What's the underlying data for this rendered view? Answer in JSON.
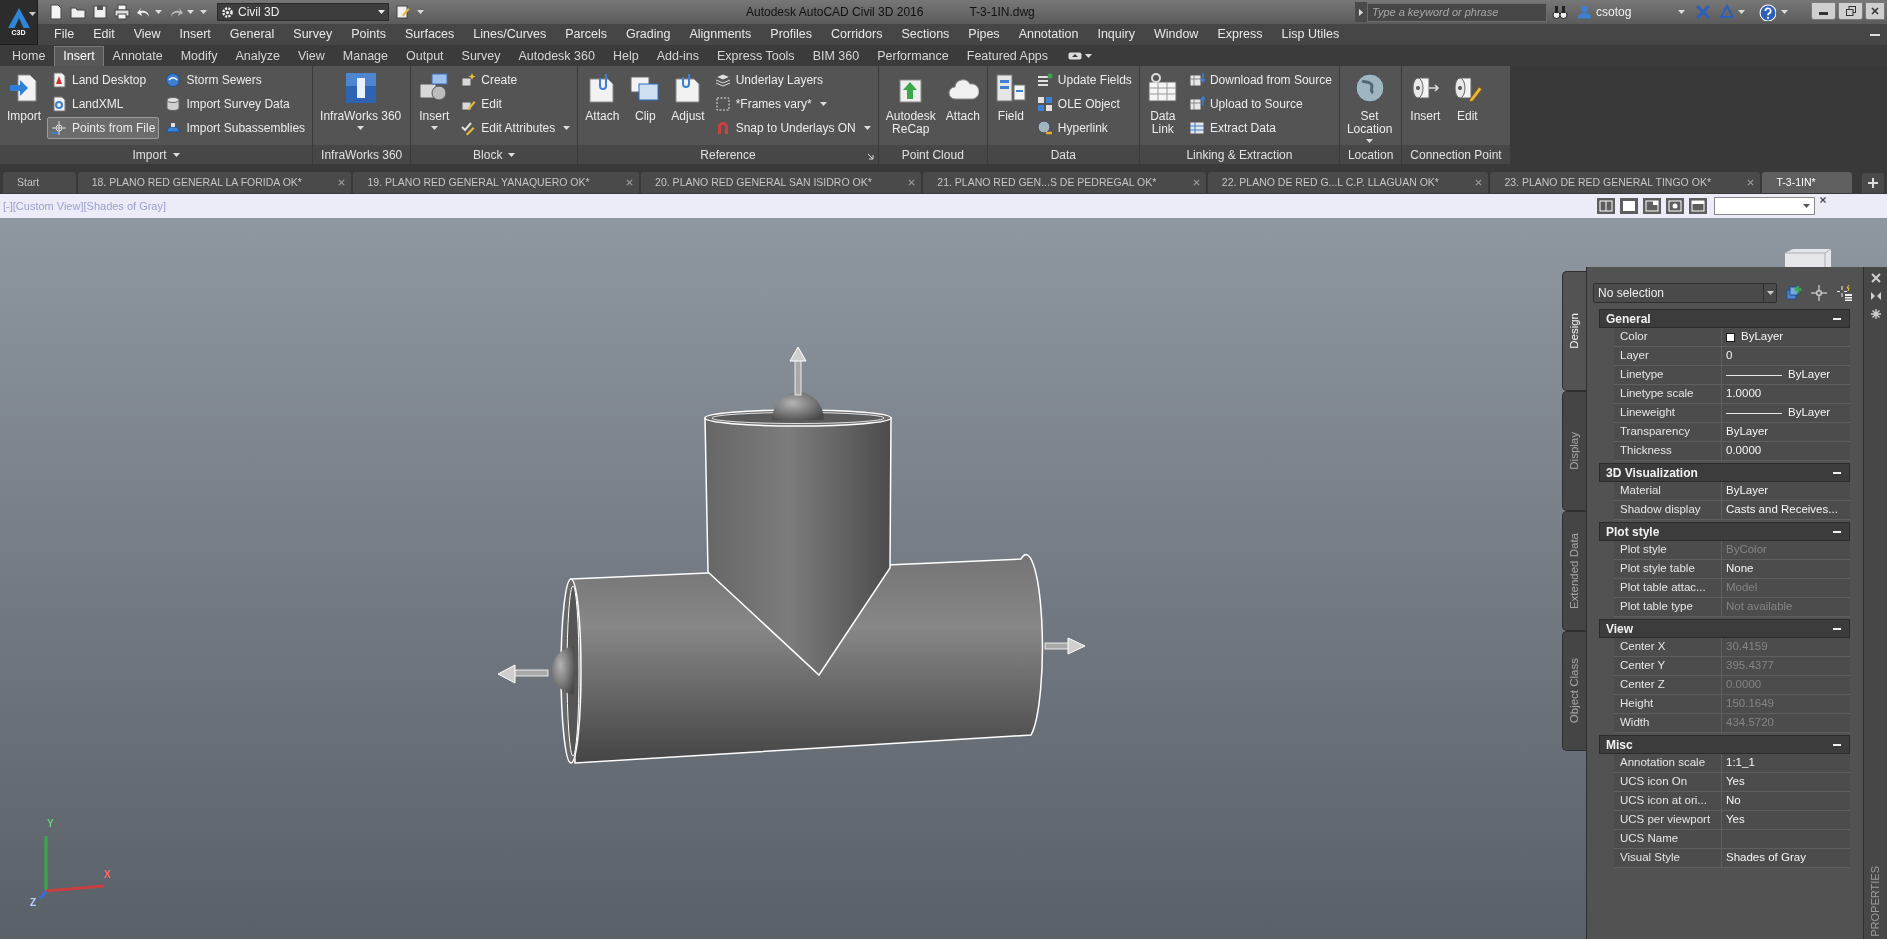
{
  "app_button": {
    "label": "C3D"
  },
  "quick_access": {
    "workspace": "Civil 3D"
  },
  "title_bar": {
    "app": "Autodesk AutoCAD Civil 3D 2016",
    "file": "T-3-1IN.dwg"
  },
  "search": {
    "placeholder": "Type a keyword or phrase"
  },
  "user": {
    "name": "csotog"
  },
  "menu_bar": [
    "File",
    "Edit",
    "View",
    "Insert",
    "General",
    "Survey",
    "Points",
    "Surfaces",
    "Lines/Curves",
    "Parcels",
    "Grading",
    "Alignments",
    "Profiles",
    "Corridors",
    "Sections",
    "Pipes",
    "Annotation",
    "Inquiry",
    "Window",
    "Express",
    "Lisp Utiles"
  ],
  "ribbon_tabs": [
    {
      "label": "Home",
      "selected": false
    },
    {
      "label": "Insert",
      "selected": true
    },
    {
      "label": "Annotate",
      "selected": false
    },
    {
      "label": "Modify",
      "selected": false
    },
    {
      "label": "Analyze",
      "selected": false
    },
    {
      "label": "View",
      "selected": false
    },
    {
      "label": "Manage",
      "selected": false
    },
    {
      "label": "Output",
      "selected": false
    },
    {
      "label": "Survey",
      "selected": false
    },
    {
      "label": "Autodesk 360",
      "selected": false
    },
    {
      "label": "Help",
      "selected": false
    },
    {
      "label": "Add-ins",
      "selected": false
    },
    {
      "label": "Express Tools",
      "selected": false
    },
    {
      "label": "BIM 360",
      "selected": false
    },
    {
      "label": "Performance",
      "selected": false
    },
    {
      "label": "Featured Apps",
      "selected": false
    }
  ],
  "ribbon_panels": [
    {
      "title": "Import",
      "menu": true,
      "launcher": false,
      "large": [
        {
          "lines": [
            "Import"
          ],
          "dropdown": false
        }
      ],
      "columns": [
        [
          {
            "label": "Land Desktop",
            "dropdown": false,
            "hovered": false
          },
          {
            "label": "LandXML",
            "dropdown": false,
            "hovered": false
          },
          {
            "label": "Points from File",
            "dropdown": false,
            "hovered": true
          }
        ],
        [
          {
            "label": "Storm Sewers",
            "dropdown": false,
            "hovered": false
          },
          {
            "label": "Import Survey Data",
            "dropdown": false,
            "hovered": false
          },
          {
            "label": "Import Subassemblies",
            "dropdown": false,
            "hovered": false
          }
        ]
      ]
    },
    {
      "title": "InfraWorks 360",
      "menu": false,
      "launcher": false,
      "large": [
        {
          "lines": [
            "InfraWorks 360"
          ],
          "dropdown": true
        }
      ]
    },
    {
      "title": "Block",
      "menu": true,
      "launcher": false,
      "large": [
        {
          "lines": [
            "Insert"
          ],
          "dropdown": true
        }
      ],
      "columns": [
        [
          {
            "label": "Create",
            "dropdown": false,
            "hovered": false
          },
          {
            "label": "Edit",
            "dropdown": false,
            "hovered": false
          },
          {
            "label": "Edit Attributes",
            "dropdown": true,
            "hovered": false
          }
        ]
      ]
    },
    {
      "title": "Reference",
      "menu": false,
      "launcher": true,
      "large": [
        {
          "lines": [
            "Attach"
          ],
          "dropdown": false
        },
        {
          "lines": [
            "Clip"
          ],
          "dropdown": false
        },
        {
          "lines": [
            "Adjust"
          ],
          "dropdown": false
        }
      ],
      "columns": [
        [
          {
            "label": "Underlay Layers",
            "dropdown": false,
            "hovered": false
          },
          {
            "label": "*Frames vary*",
            "dropdown": true,
            "hovered": false
          },
          {
            "label": "Snap to Underlays ON",
            "dropdown": true,
            "hovered": false
          }
        ]
      ]
    },
    {
      "title": "Point Cloud",
      "menu": false,
      "launcher": false,
      "large": [
        {
          "lines": [
            "Autodesk",
            "ReCap"
          ],
          "dropdown": false
        },
        {
          "lines": [
            "Attach"
          ],
          "dropdown": false
        }
      ]
    },
    {
      "title": "Data",
      "menu": false,
      "launcher": false,
      "large": [
        {
          "lines": [
            "Field"
          ],
          "dropdown": false
        }
      ],
      "columns": [
        [
          {
            "label": "Update Fields",
            "dropdown": false,
            "hovered": false
          },
          {
            "label": "OLE Object",
            "dropdown": false,
            "hovered": false
          },
          {
            "label": "Hyperlink",
            "dropdown": false,
            "hovered": false
          }
        ]
      ]
    },
    {
      "title": "Linking & Extraction",
      "menu": false,
      "launcher": false,
      "large": [
        {
          "lines": [
            "Data",
            "Link"
          ],
          "dropdown": false
        }
      ],
      "columns": [
        [
          {
            "label": "Download from Source",
            "dropdown": false,
            "hovered": false
          },
          {
            "label": "Upload to Source",
            "dropdown": false,
            "hovered": false
          },
          {
            "label": "Extract Data",
            "dropdown": false,
            "hovered": false
          }
        ]
      ]
    },
    {
      "title": "Location",
      "menu": false,
      "launcher": false,
      "large": [
        {
          "lines": [
            "Set",
            "Location"
          ],
          "dropdown": true
        }
      ]
    },
    {
      "title": "Connection Point",
      "menu": false,
      "launcher": false,
      "large": [
        {
          "lines": [
            "Insert"
          ],
          "dropdown": false
        },
        {
          "lines": [
            "Edit"
          ],
          "dropdown": false
        }
      ]
    }
  ],
  "document_tabs": [
    {
      "label": "Start",
      "selected": false,
      "closable": false
    },
    {
      "label": "18. PLANO RED GENERAL LA FORIDA OK*",
      "selected": false,
      "closable": true
    },
    {
      "label": "19. PLANO RED GENERAL YANAQUERO OK*",
      "selected": false,
      "closable": true
    },
    {
      "label": "20. PLANO RED GENERAL SAN ISIDRO OK*",
      "selected": false,
      "closable": true
    },
    {
      "label": "21. PLANO RED GEN...S DE PEDREGAL OK*",
      "selected": false,
      "closable": true
    },
    {
      "label": "22. PLANO DE RED G...L C.P. LLAGUAN OK*",
      "selected": false,
      "closable": true
    },
    {
      "label": "23. PLANO DE RED GENERAL TINGO OK*",
      "selected": false,
      "closable": true
    },
    {
      "label": "T-3-1IN*",
      "selected": true,
      "closable": false
    }
  ],
  "viewport": {
    "controls": [
      "[-]",
      "[Custom View]",
      "[Shades of Gray]"
    ],
    "ucs_icon": {
      "x": "X",
      "y": "Y",
      "z": "Z"
    }
  },
  "properties": {
    "title": "PROPERTIES",
    "selection": "No selection",
    "side_tabs": [
      {
        "label": "Design",
        "selected": true
      },
      {
        "label": "Display",
        "selected": false
      },
      {
        "label": "Extended Data",
        "selected": false
      },
      {
        "label": "Object Class",
        "selected": false
      }
    ],
    "sections": [
      {
        "title": "General",
        "expanded": true,
        "rows": [
          {
            "label": "Color",
            "value": "ByLayer",
            "kind": "color",
            "color": "#ffffff",
            "disabled": false
          },
          {
            "label": "Layer",
            "value": "0",
            "kind": "text",
            "disabled": false
          },
          {
            "label": "Linetype",
            "value": "ByLayer",
            "kind": "line",
            "disabled": false
          },
          {
            "label": "Linetype scale",
            "value": "1.0000",
            "kind": "text",
            "disabled": false
          },
          {
            "label": "Lineweight",
            "value": "ByLayer",
            "kind": "line",
            "disabled": false
          },
          {
            "label": "Transparency",
            "value": "ByLayer",
            "kind": "text",
            "disabled": false
          },
          {
            "label": "Thickness",
            "value": "0.0000",
            "kind": "text",
            "disabled": false
          }
        ]
      },
      {
        "title": "3D Visualization",
        "expanded": true,
        "rows": [
          {
            "label": "Material",
            "value": "ByLayer",
            "kind": "text",
            "disabled": false
          },
          {
            "label": "Shadow display",
            "value": "Casts and Receives...",
            "kind": "text",
            "disabled": false
          }
        ]
      },
      {
        "title": "Plot style",
        "expanded": true,
        "rows": [
          {
            "label": "Plot style",
            "value": "ByColor",
            "kind": "text",
            "disabled": true
          },
          {
            "label": "Plot style table",
            "value": "None",
            "kind": "text",
            "disabled": false
          },
          {
            "label": "Plot table attac...",
            "value": "Model",
            "kind": "text",
            "disabled": true
          },
          {
            "label": "Plot table type",
            "value": "Not available",
            "kind": "text",
            "disabled": true
          }
        ]
      },
      {
        "title": "View",
        "expanded": true,
        "rows": [
          {
            "label": "Center X",
            "value": "30.4159",
            "kind": "text",
            "disabled": true
          },
          {
            "label": "Center Y",
            "value": "395.4377",
            "kind": "text",
            "disabled": true
          },
          {
            "label": "Center Z",
            "value": "0.0000",
            "kind": "text",
            "disabled": true
          },
          {
            "label": "Height",
            "value": "150.1649",
            "kind": "text",
            "disabled": true
          },
          {
            "label": "Width",
            "value": "434.5720",
            "kind": "text",
            "disabled": true
          }
        ]
      },
      {
        "title": "Misc",
        "expanded": true,
        "rows": [
          {
            "label": "Annotation scale",
            "value": "1:1_1",
            "kind": "text",
            "disabled": false
          },
          {
            "label": "UCS icon On",
            "value": "Yes",
            "kind": "text",
            "disabled": false
          },
          {
            "label": "UCS icon at ori...",
            "value": "No",
            "kind": "text",
            "disabled": false
          },
          {
            "label": "UCS per viewport",
            "value": "Yes",
            "kind": "text",
            "disabled": false
          },
          {
            "label": "UCS Name",
            "kind": "text"
          },
          {
            "label": "Visual Style",
            "value": "Shades of Gray",
            "kind": "text",
            "disabled": false
          }
        ]
      }
    ]
  }
}
